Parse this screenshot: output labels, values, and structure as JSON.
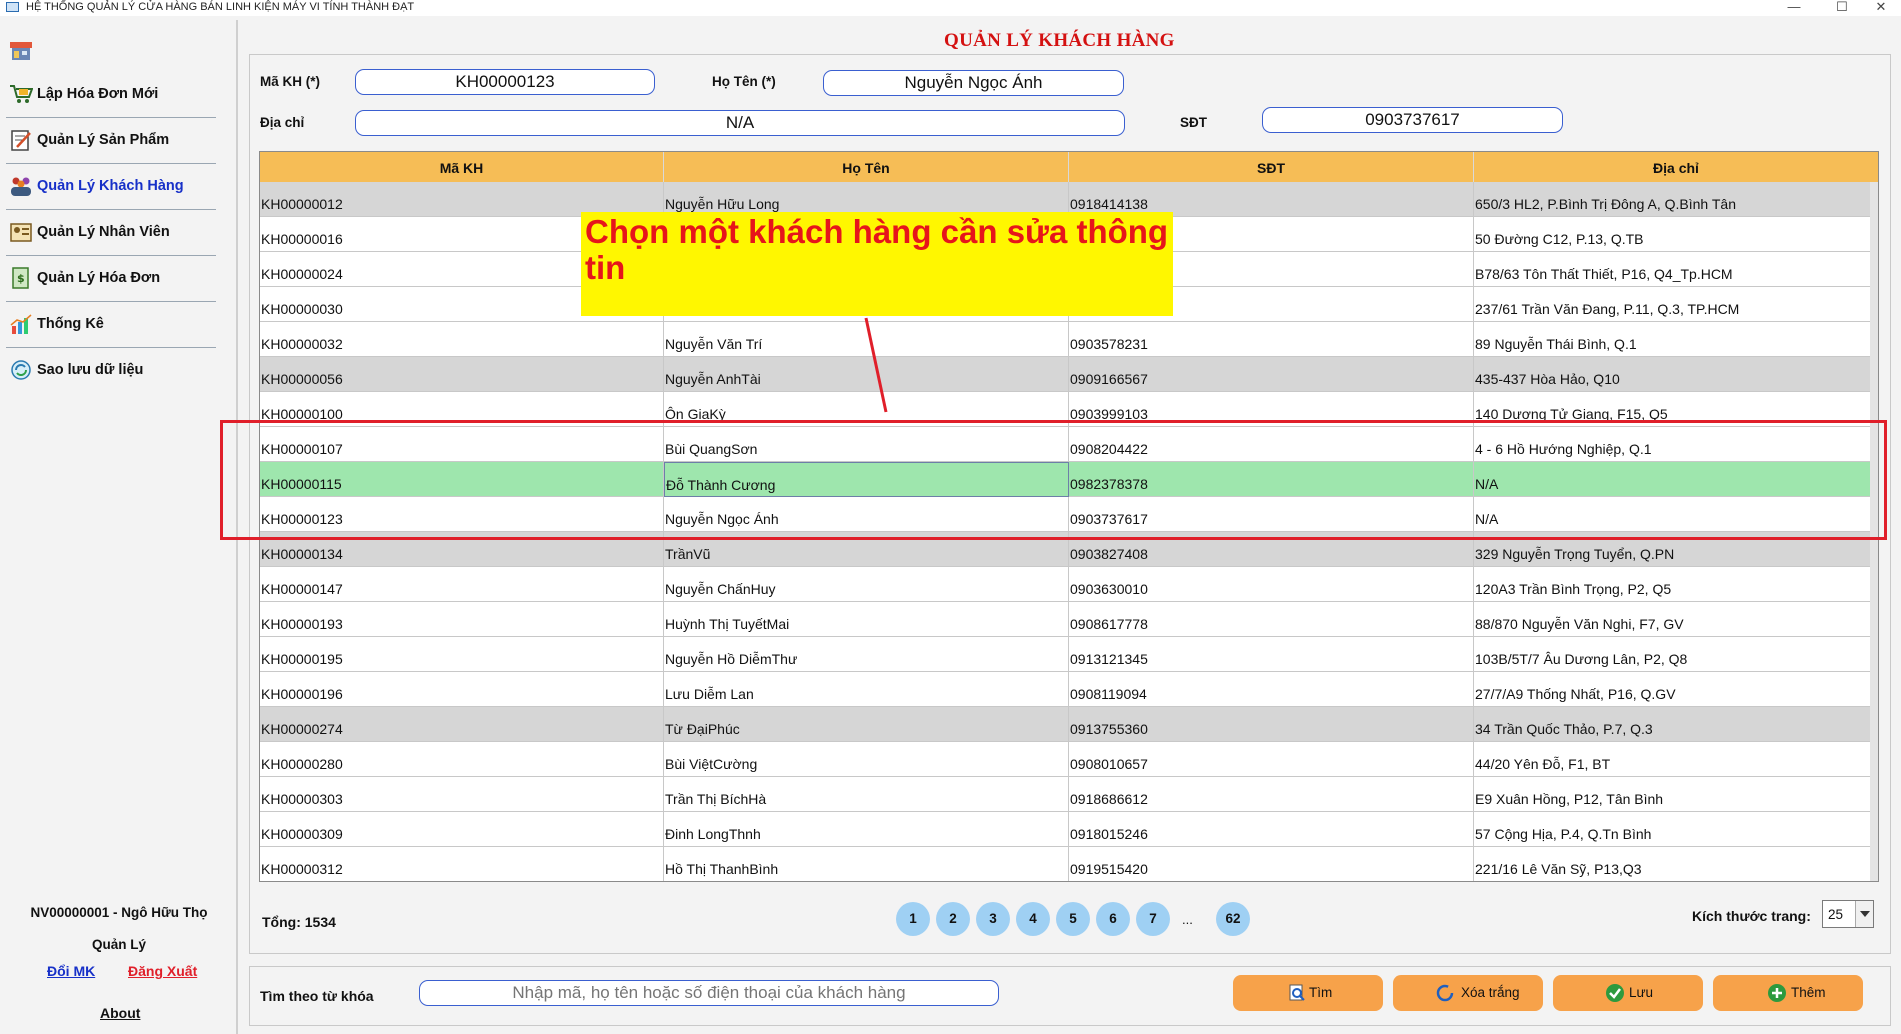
{
  "window": {
    "title": "HỆ THỐNG QUẢN LÝ CỬA HÀNG BÁN LINH KIỆN MÁY VI TÍNH THÀNH ĐẠT",
    "minimize": "—",
    "maximize": "☐",
    "close": "✕"
  },
  "sidebar": {
    "items": [
      {
        "label": "Lập Hóa Đơn Mới",
        "icon": "cart-icon"
      },
      {
        "label": "Quản Lý Sản Phẩm",
        "icon": "notebook-icon"
      },
      {
        "label": "Quản Lý Khách Hàng",
        "icon": "customers-icon",
        "active": true
      },
      {
        "label": "Quản Lý Nhân Viên",
        "icon": "id-card-icon"
      },
      {
        "label": "Quản Lý Hóa Đơn",
        "icon": "invoice-icon"
      },
      {
        "label": "Thống Kê",
        "icon": "chart-icon"
      },
      {
        "label": "Sao lưu dữ liệu",
        "icon": "backup-icon"
      }
    ],
    "user_line": "NV00000001 - Ngô Hữu  Thọ",
    "role": "Quản Lý",
    "change_password": "Đổi MK",
    "logout": "Đăng Xuất",
    "about": "About"
  },
  "page_title": "QUẢN LÝ KHÁCH HÀNG",
  "form": {
    "id_label": "Mã KH (*)",
    "id_value": "KH00000123",
    "name_label": "Họ Tên (*)",
    "name_value": "Nguyễn Ngọc Ánh",
    "address_label": "Địa chỉ",
    "address_value": "N/A",
    "phone_label": "SĐT",
    "phone_value": "0903737617"
  },
  "table": {
    "columns": [
      "Mã KH",
      "Họ Tên",
      "SĐT",
      "Địa chỉ"
    ],
    "rows": [
      {
        "id": "KH00000012",
        "name": "Nguyễn Hữu Long",
        "phone": "0918414138",
        "address": "650/3 HL2, P.Bình Trị Đông A, Q.Bình Tân",
        "alt": true
      },
      {
        "id": "KH00000016",
        "name": "",
        "phone": "",
        "address": "50 Đường C12, P.13, Q.TB"
      },
      {
        "id": "KH00000024",
        "name": "",
        "phone": "",
        "address": "B78/63 Tôn Thất Thiết, P16, Q4_Tp.HCM"
      },
      {
        "id": "KH00000030",
        "name": "",
        "phone": "",
        "address": "237/61 Trần Văn Đang, P.11, Q.3, TP.HCM"
      },
      {
        "id": "KH00000032",
        "name": "Nguyễn Văn Trí",
        "phone": "0903578231",
        "address": "89 Nguyễn Thái Bình, Q.1"
      },
      {
        "id": "KH00000056",
        "name": "Nguyễn AnhTài",
        "phone": "0909166567",
        "address": "435-437 Hòa Hảo, Q10",
        "alt": true
      },
      {
        "id": "KH00000100",
        "name": "Ôn GiaKỳ",
        "phone": "0903999103",
        "address": "140 Dương Tử Giang, F15, Q5"
      },
      {
        "id": "KH00000107",
        "name": "Bùi QuangSơn",
        "phone": "0908204422",
        "address": "4 - 6 Hồ Hướng Nghiệp, Q.1"
      },
      {
        "id": "KH00000115",
        "name": "Đỗ Thành Cương",
        "phone": "0982378378",
        "address": "N/A",
        "selected": true
      },
      {
        "id": "KH00000123",
        "name": "Nguyễn Ngọc Ánh",
        "phone": "0903737617",
        "address": "N/A"
      },
      {
        "id": "KH00000134",
        "name": "TrầnVũ",
        "phone": "0903827408",
        "address": "329 Nguyễn Trọng Tuyển, Q.PN",
        "alt": true
      },
      {
        "id": "KH00000147",
        "name": "Nguyễn ChấnHuy",
        "phone": "0903630010",
        "address": "120A3 Trần Bình Trọng, P2, Q5"
      },
      {
        "id": "KH00000193",
        "name": "Huỳnh Thị TuyếtMai",
        "phone": "0908617778",
        "address": "88/870 Nguyễn Văn Nghi, F7, GV"
      },
      {
        "id": "KH00000195",
        "name": "Nguyễn Hồ DiễmThư",
        "phone": "0913121345",
        "address": "103B/5T/7 Âu Dương Lân, P2, Q8"
      },
      {
        "id": "KH00000196",
        "name": "Lưu Diễm Lan",
        "phone": "0908119094",
        "address": "27/7/A9 Thống Nhất, P16, Q.GV"
      },
      {
        "id": "KH00000274",
        "name": "Từ ĐạiPhúc",
        "phone": "0913755360",
        "address": "34 Trần Quốc Thảo, P.7, Q.3",
        "alt": true
      },
      {
        "id": "KH00000280",
        "name": "Bùi ViệtCường",
        "phone": "0908010657",
        "address": "44/20 Yên Đỗ, F1, BT"
      },
      {
        "id": "KH00000303",
        "name": "Trần Thị BíchHà",
        "phone": "0918686612",
        "address": "E9 Xuân Hồng, P12, Tân Bình"
      },
      {
        "id": "KH00000309",
        "name": "Đinh LongThnh",
        "phone": "0918015246",
        "address": "57 Cộng Hịa, P.4, Q.Tn Bình"
      },
      {
        "id": "KH00000312",
        "name": "Hồ Thị ThanhBình",
        "phone": "0919515420",
        "address": "221/16 Lê Văn Sỹ, P13,Q3"
      }
    ]
  },
  "annotation": {
    "callout_text": "Chọn một khách hàng cần sửa thông tin"
  },
  "pagination": {
    "total_label": "Tổng: 1534",
    "pages": [
      "1",
      "2",
      "3",
      "4",
      "5",
      "6",
      "7"
    ],
    "ellipsis": "...",
    "last_page": "62",
    "page_size_label": "Kích thước trang:",
    "page_size_value": "25"
  },
  "search": {
    "label": "Tìm theo từ khóa",
    "placeholder": "Nhập mã, họ tên hoặc số điện thoại của khách hàng"
  },
  "actions": {
    "find": "Tìm",
    "clear": "Xóa trắng",
    "save": "Lưu",
    "add": "Thêm"
  },
  "colors": {
    "title_red": "#d41111",
    "header_orange": "#f6bd56",
    "selected_row": "#9ee6ad",
    "button_orange": "#f7a24a",
    "pager_blue": "#9fd0f3",
    "active_nav": "#1730c8"
  }
}
